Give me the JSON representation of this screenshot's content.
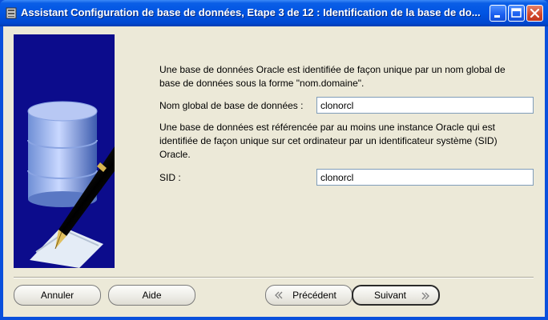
{
  "window": {
    "title": "Assistant Configuration de base de données, Etape 3 de 12 : Identification de la base de do..."
  },
  "content": {
    "intro_text_line1": "Une base de données Oracle est identifiée de façon unique par un nom global de",
    "intro_text_line2": "base de données sous la forme \"nom.domaine\".",
    "global_name_label": "Nom global de base de données :",
    "global_name_value": "clonorcl",
    "sid_text_line1": "Une base de données est référencée par au moins une instance Oracle qui est",
    "sid_text_line2": "identifiée de façon unique sur cet ordinateur par un identificateur système (SID)",
    "sid_text_line3": "Oracle.",
    "sid_label": "SID :",
    "sid_value": "clonorcl"
  },
  "buttons": {
    "cancel": "Annuler",
    "help": "Aide",
    "previous": "Précédent",
    "next": "Suivant"
  },
  "icons": {
    "app": "database-wizard-icon",
    "minimize": "minimize-icon",
    "maximize": "maximize-icon",
    "close": "close-icon",
    "previous": "chevron-left-icon",
    "next": "chevron-right-icon"
  },
  "colors": {
    "titlebar": "#0054e3",
    "panel_bg": "#0c0c8c",
    "client_bg": "#ece9d8"
  }
}
